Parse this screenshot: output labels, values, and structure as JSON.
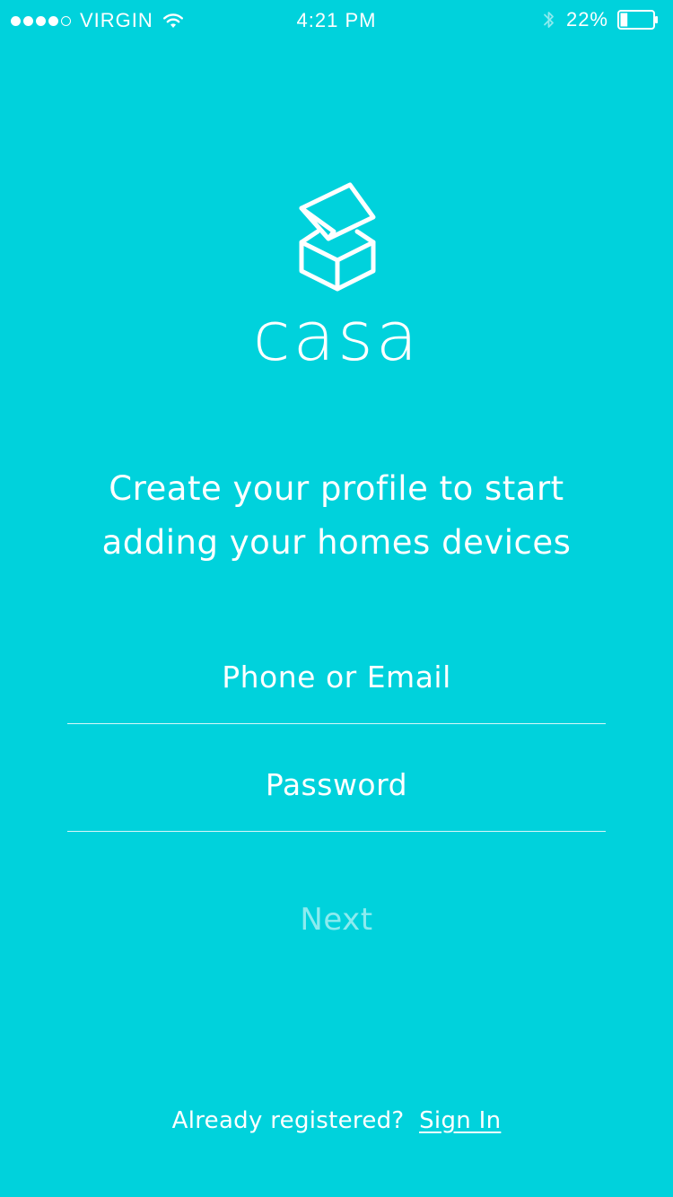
{
  "status_bar": {
    "carrier": "VIRGIN",
    "time": "4:21 PM",
    "battery_percent": "22%",
    "battery_level": 0.22,
    "signal_bars_filled": 4,
    "signal_bars_total": 5
  },
  "brand": {
    "name": "casa"
  },
  "tagline": "Create your profile to start adding your homes devices",
  "form": {
    "email_placeholder": "Phone or Email",
    "password_placeholder": "Password",
    "next_label": "Next"
  },
  "footer": {
    "prompt": "Already registered?",
    "signin_label": "Sign In"
  },
  "colors": {
    "background": "#00D2DC",
    "text": "#FFFFFF"
  }
}
